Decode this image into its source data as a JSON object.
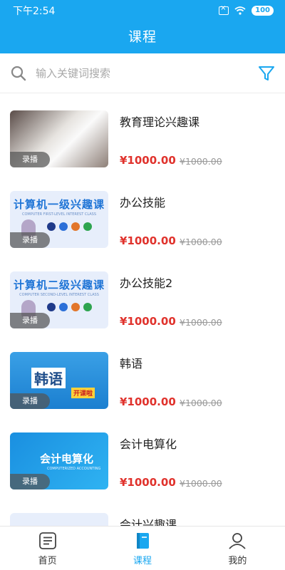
{
  "status_bar": {
    "time": "下午2:54",
    "battery": "100"
  },
  "header": {
    "title": "课程"
  },
  "search": {
    "placeholder": "输入关键词搜索"
  },
  "courses": [
    {
      "title": "教育理论兴趣课",
      "price": "¥1000.00",
      "original_price": "¥1000.00",
      "badge": "录播",
      "thumb_text": "",
      "thumb_sub": ""
    },
    {
      "title": "办公技能",
      "price": "¥1000.00",
      "original_price": "¥1000.00",
      "badge": "录播",
      "thumb_text": "计算机一级兴趣课",
      "thumb_sub": "COMPUTER FIRST-LEVEL INTEREST CLASS"
    },
    {
      "title": "办公技能2",
      "price": "¥1000.00",
      "original_price": "¥1000.00",
      "badge": "录播",
      "thumb_text": "计算机二级兴趣课",
      "thumb_sub": "COMPUTER SECOND-LEVEL INTEREST CLASS"
    },
    {
      "title": "韩语",
      "price": "¥1000.00",
      "original_price": "¥1000.00",
      "badge": "录播",
      "thumb_text": "韩语",
      "thumb_sub": "开课啦"
    },
    {
      "title": "会计电算化",
      "price": "¥1000.00",
      "original_price": "¥1000.00",
      "badge": "录播",
      "thumb_text": "会计电算化",
      "thumb_sub": "COMPUTERIZED ACCOUNTING"
    },
    {
      "title": "会计兴趣课",
      "price": "",
      "original_price": "",
      "badge": "",
      "thumb_text": "",
      "thumb_sub": ""
    }
  ],
  "tabbar": {
    "items": [
      {
        "label": "首页",
        "icon": "list-icon",
        "active": false
      },
      {
        "label": "课程",
        "icon": "book-icon",
        "active": true
      },
      {
        "label": "我的",
        "icon": "user-icon",
        "active": false
      }
    ]
  },
  "colors": {
    "accent": "#1aa7f0",
    "price": "#e0322c"
  }
}
